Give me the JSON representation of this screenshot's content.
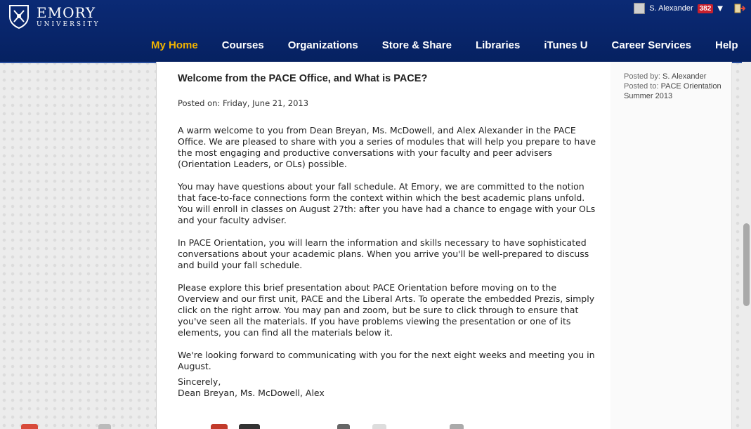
{
  "header": {
    "logo": {
      "name": "EMORY",
      "sub": "UNIVERSITY"
    },
    "user": {
      "name": "S. Alexander",
      "badge": "382"
    },
    "colors": {
      "bar": "#062161",
      "accent": "#f2b400",
      "badge": "#c8202e"
    },
    "nav": [
      {
        "label": "My Home",
        "active": true
      },
      {
        "label": "Courses"
      },
      {
        "label": "Organizations"
      },
      {
        "label": "Store & Share"
      },
      {
        "label": "Libraries"
      },
      {
        "label": "iTunes U"
      },
      {
        "label": "Career Services"
      },
      {
        "label": "Help"
      }
    ]
  },
  "post": {
    "title": "Welcome from the PACE Office, and What is PACE?",
    "date": "Posted on: Friday, June 21, 2013",
    "paragraphs": [
      "A warm welcome to you from Dean Breyan, Ms. McDowell, and Alex Alexander in the PACE Office.  We are pleased to share with you a series of modules that will help you prepare to have the most engaging and productive conversations with your faculty and peer advisers (Orientation Leaders, or OLs) possible.",
      "You may have questions about your fall schedule.  At Emory, we are committed to the notion that face-to-face connections form the context within which the best academic plans unfold.  You will enroll in classes on August 27th: after you have had a chance to engage with your OLs and your faculty adviser.",
      "In PACE Orientation, you will learn the  information and skills necessary to have sophisticated conversations about your academic plans.  When you arrive you'll be well-prepared to discuss and build your fall schedule.",
      "Please explore this brief presentation about PACE Orientation before moving on to the Overview and our first unit, PACE and the Liberal Arts.  To operate the embedded Prezis, simply click on the right arrow.  You may pan and zoom, but be sure to click through to ensure that you've seen all the materials.  If you have problems viewing the presentation or one of its elements, you can find all the materials below it.",
      "We're looking forward  to communicating with you for the next eight weeks and meeting you in August."
    ],
    "closing": "Sincerely,",
    "signature": "Dean Breyan, Ms. McDowell, Alex"
  },
  "meta": {
    "posted_by_label": "Posted by:",
    "posted_by": "S. Alexander",
    "posted_to_label": "Posted to:",
    "posted_to": "PACE Orientation Summer 2013"
  }
}
